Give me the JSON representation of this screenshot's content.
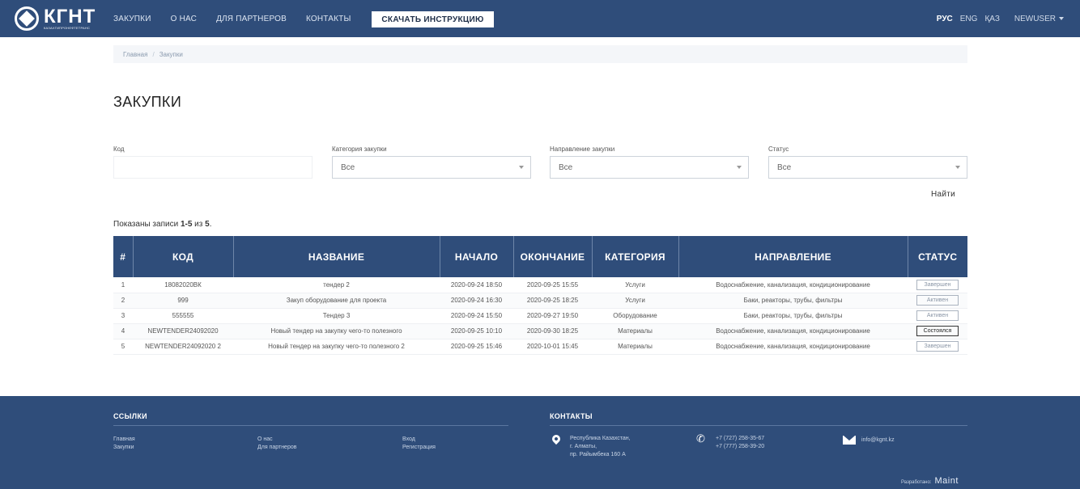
{
  "header": {
    "logo_text": "КГНТ",
    "logo_subtext": "КАЗАХГИПРОНЕФТЕТРАНС",
    "nav": [
      "ЗАКУПКИ",
      "О НАС",
      "ДЛЯ ПАРТНЕРОВ",
      "КОНТАКТЫ"
    ],
    "download_button": "СКАЧАТЬ ИНСТРУКЦИЮ",
    "langs": [
      "РУС",
      "ENG",
      "ҚАЗ"
    ],
    "user": "NEWUSER"
  },
  "breadcrumb": [
    "Главная",
    "Закупки"
  ],
  "page_title": "ЗАКУПКИ",
  "filters": {
    "code_label": "Код",
    "code_value": "",
    "category_label": "Категория закупки",
    "category_value": "Все",
    "direction_label": "Направление закупки",
    "direction_value": "Все",
    "status_label": "Статус",
    "status_value": "Все",
    "find_button": "Найти"
  },
  "summary": {
    "prefix": "Показаны записи ",
    "range": "1-5",
    "middle": " из ",
    "total": "5",
    "suffix": "."
  },
  "table": {
    "headers": [
      "#",
      "КОД",
      "НАЗВАНИЕ",
      "НАЧАЛО",
      "ОКОНЧАНИЕ",
      "КАТЕГОРИЯ",
      "НАПРАВЛЕНИЕ",
      "СТАТУС"
    ],
    "rows": [
      {
        "n": "1",
        "code": "18082020ВК",
        "name": "тендер 2",
        "start": "2020-09-24 18:50",
        "end": "2020-09-25 15:55",
        "category": "Услуги",
        "direction": "Водоснабжение, канализация, кондиционирование",
        "status": "Завершен"
      },
      {
        "n": "2",
        "code": "999",
        "name": "Закуп оборудование для проекта",
        "start": "2020-09-24 16:30",
        "end": "2020-09-25 18:25",
        "category": "Услуги",
        "direction": "Баки, реакторы, трубы, фильтры",
        "status": "Активен"
      },
      {
        "n": "3",
        "code": "555555",
        "name": "Тендер 3",
        "start": "2020-09-24 15:50",
        "end": "2020-09-27 19:50",
        "category": "Оборудование",
        "direction": "Баки, реакторы, трубы, фильтры",
        "status": "Активен"
      },
      {
        "n": "4",
        "code": "NEWTENDER24092020",
        "name": "Новый тендер на закупку чего-то полезного",
        "start": "2020-09-25 10:10",
        "end": "2020-09-30 18:25",
        "category": "Материалы",
        "direction": "Водоснабжение, канализация, кондиционирование",
        "status": "Состоялся"
      },
      {
        "n": "5",
        "code": "NEWTENDER24092020 2",
        "name": "Новый тендер на закупку чего-то полезного 2",
        "start": "2020-09-25 15:46",
        "end": "2020-10-01 15:45",
        "category": "Материалы",
        "direction": "Водоснабжение, канализация, кондиционирование",
        "status": "Завершен"
      }
    ]
  },
  "footer": {
    "links_title": "ССЫЛКИ",
    "links": [
      "Главная",
      "Закупки",
      "О нас",
      "Для партнеров",
      "Вход",
      "Регистрация"
    ],
    "contacts_title": "КОНТАКТЫ",
    "address": [
      "Республика Казахстан,",
      "г. Алматы,",
      "пр. Райымбека 160 А"
    ],
    "phones": [
      "+7 (727) 258-35-67",
      "+7 (777) 258-39-20"
    ],
    "email": "info@kgnt.kz",
    "developer_label": "Разработано:",
    "developer_name": "Maint"
  }
}
